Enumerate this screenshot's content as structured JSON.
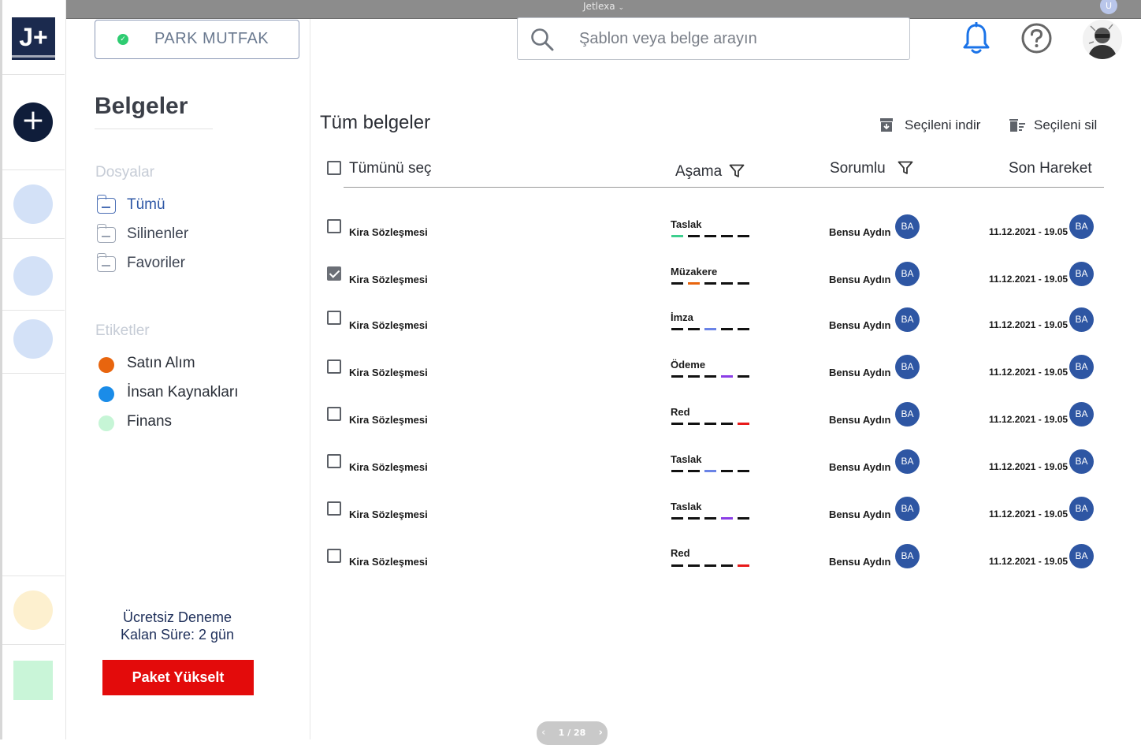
{
  "window_title": "Jetlexa",
  "window_avatar": "U",
  "logo": "J+",
  "workspace": {
    "name": "PARK MUTFAK"
  },
  "sidebar": {
    "title": "Belgeler",
    "folders_heading": "Dosyalar",
    "folders": [
      {
        "label": "Tümü",
        "active": true
      },
      {
        "label": "Silinenler",
        "active": false
      },
      {
        "label": "Favoriler",
        "active": false
      }
    ],
    "tags_heading": "Etiketler",
    "tags": [
      {
        "label": "Satın Alım",
        "color": "#e8650e"
      },
      {
        "label": "İnsan Kaynakları",
        "color": "#1a8ce8"
      },
      {
        "label": "Finans",
        "color": "#c6f5d6"
      }
    ],
    "trial_line1": "Ücretsiz Deneme",
    "trial_line2": "Kalan Süre: 2 gün",
    "upgrade_label": "Paket Yükselt"
  },
  "search": {
    "placeholder": "Şablon veya belge arayın"
  },
  "main": {
    "title": "Tüm belgeler",
    "download_label": "Seçileni indir",
    "delete_label": "Seçileni sil",
    "select_all_label": "Tümünü seç",
    "columns": {
      "stage": "Aşama",
      "owner": "Sorumlu",
      "last": "Son Hareket"
    },
    "rows": [
      {
        "name": "Kira Sözleşmesi",
        "checked": false,
        "stage": "Taslak",
        "segs": [
          "#3ecf8e",
          "#111",
          "#111",
          "#111",
          "#111"
        ],
        "owner": "Bensu Aydın",
        "owner_initials": "BA",
        "date": "11.12.2021 - 19.05",
        "last_initials": "BA"
      },
      {
        "name": "Kira Sözleşmesi",
        "checked": true,
        "stage": "Müzakere",
        "segs": [
          "#111",
          "#e8650e",
          "#111",
          "#111",
          "#111"
        ],
        "owner": "Bensu Aydın",
        "owner_initials": "BA",
        "date": "11.12.2021 - 19.05",
        "last_initials": "BA"
      },
      {
        "name": "Kira Sözleşmesi",
        "checked": false,
        "stage": "İmza",
        "segs": [
          "#111",
          "#111",
          "#6a83e6",
          "#111",
          "#111"
        ],
        "owner": "Bensu Aydın",
        "owner_initials": "BA",
        "date": "11.12.2021 - 19.05",
        "last_initials": "BA"
      },
      {
        "name": "Kira Sözleşmesi",
        "checked": false,
        "stage": "Ödeme",
        "segs": [
          "#111",
          "#111",
          "#111",
          "#8b3ee6",
          "#111"
        ],
        "owner": "Bensu Aydın",
        "owner_initials": "BA",
        "date": "11.12.2021 - 19.05",
        "last_initials": "BA"
      },
      {
        "name": "Kira Sözleşmesi",
        "checked": false,
        "stage": "Red",
        "segs": [
          "#111",
          "#111",
          "#111",
          "#111",
          "#e81a1a"
        ],
        "owner": "Bensu Aydın",
        "owner_initials": "BA",
        "date": "11.12.2021 - 19.05",
        "last_initials": "BA"
      },
      {
        "name": "Kira Sözleşmesi",
        "checked": false,
        "stage": "Taslak",
        "segs": [
          "#111",
          "#111",
          "#6a83e6",
          "#111",
          "#111"
        ],
        "owner": "Bensu Aydın",
        "owner_initials": "BA",
        "date": "11.12.2021 - 19.05",
        "last_initials": "BA"
      },
      {
        "name": "Kira Sözleşmesi",
        "checked": false,
        "stage": "Taslak",
        "segs": [
          "#111",
          "#111",
          "#111",
          "#8b3ee6",
          "#111"
        ],
        "owner": "Bensu Aydın",
        "owner_initials": "BA",
        "date": "11.12.2021 - 19.05",
        "last_initials": "BA"
      },
      {
        "name": "Kira Sözleşmesi",
        "checked": false,
        "stage": "Red",
        "segs": [
          "#111",
          "#111",
          "#111",
          "#111",
          "#e81a1a"
        ],
        "owner": "Bensu Aydın",
        "owner_initials": "BA",
        "date": "11.12.2021 - 19.05",
        "last_initials": "BA"
      }
    ]
  },
  "pager": {
    "label": "1 / 28"
  },
  "colors": {
    "brand": "#1b2a4e",
    "accent": "#2e56a3",
    "upgrade": "#e30b0b",
    "bell": "#1a73e8"
  }
}
